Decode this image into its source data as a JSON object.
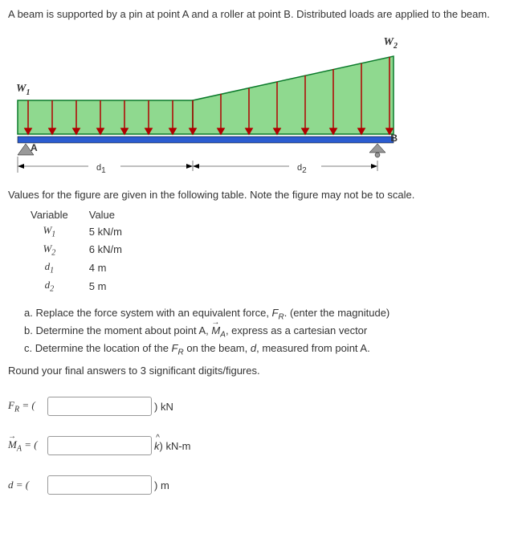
{
  "problem_statement": "A beam is supported by a pin at point A and a roller at point B. Distributed loads are applied to the beam.",
  "figure": {
    "w1_label": "W",
    "w1_sub": "1",
    "w2_label": "W",
    "w2_sub": "2",
    "a_label": "A",
    "b_label": "B",
    "d1_label": "d",
    "d1_sub": "1",
    "d2_label": "d",
    "d2_sub": "2"
  },
  "table_intro": "Values for the figure are given in the following table. Note the figure may not be to scale.",
  "table": {
    "headers": [
      "Variable",
      "Value"
    ],
    "rows": [
      {
        "var": "W",
        "sub": "1",
        "val": "5 kN/m"
      },
      {
        "var": "W",
        "sub": "2",
        "val": "6 kN/m"
      },
      {
        "var": "d",
        "sub": "1",
        "val": "4 m"
      },
      {
        "var": "d",
        "sub": "2",
        "val": "5 m"
      }
    ]
  },
  "questions": {
    "a": "a. Replace the force system with an equivalent force, ",
    "a_var": "F",
    "a_sub": "R",
    "a_after": ". (enter the magnitude)",
    "b": "b. Determine the moment about point A, ",
    "b_var": "M",
    "b_sub": "A",
    "b_after": ", express as a cartesian vector",
    "c_before": "c. Determine the location of the ",
    "c_var": "F",
    "c_sub": "R",
    "c_mid": " on the beam, ",
    "c_var2": "d",
    "c_after": ", measured from point A."
  },
  "round_text": "Round your final answers to 3 significant digits/figures.",
  "answers": {
    "fr_label": "F",
    "fr_sub": "R",
    "fr_eq": " = (",
    "fr_unit": ") kN",
    "ma_label": "M",
    "ma_sub": "A",
    "ma_eq": " = (",
    "ma_unit_k": "k",
    "ma_unit_after": ") kN-m",
    "d_label": "d",
    "d_eq": " = (",
    "d_unit": ") m"
  }
}
